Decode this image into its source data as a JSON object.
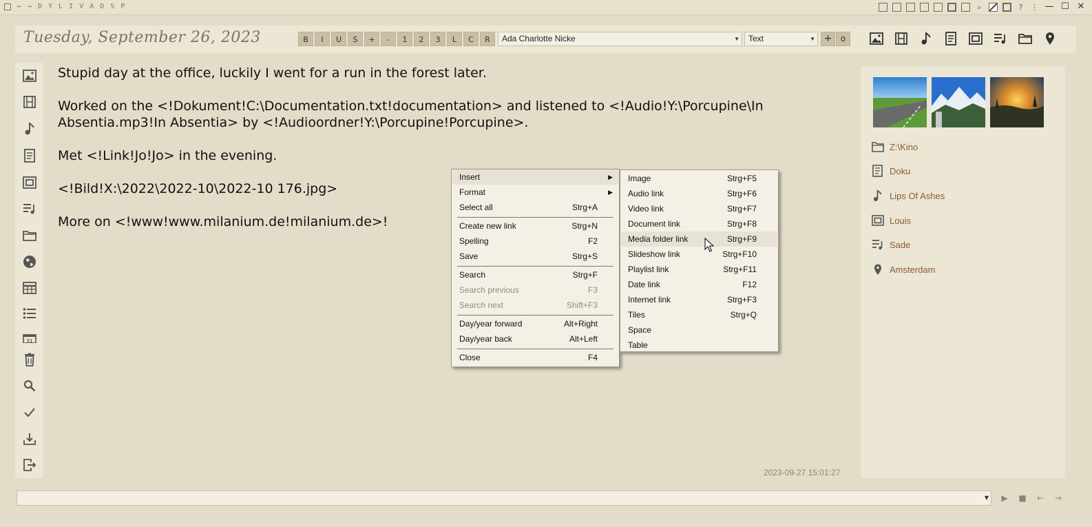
{
  "titlebar": {
    "letters": [
      "D",
      "Y",
      "L",
      "I",
      "V",
      "A",
      "D",
      "S",
      "P"
    ],
    "right_icons": [
      "window-icon",
      "list-icon",
      "lock-icon",
      "bookmark-icon",
      "grid-icon",
      "frame-icon",
      "page-icon",
      "search-icon",
      "image-edit-icon",
      "columns-icon",
      "help-icon"
    ],
    "help": "?",
    "more": "⋮"
  },
  "header": {
    "date": "Tuesday, September 26, 2023",
    "format_buttons": [
      "B",
      "I",
      "U",
      "S",
      "+",
      "-",
      "1",
      "2",
      "3",
      "L",
      "C",
      "R"
    ],
    "font_value": "Ada Charlotte Nicke",
    "style_value": "Text",
    "plus": "+",
    "o": "o",
    "media_icons": [
      "image-icon",
      "film-icon",
      "music-icon",
      "document-icon",
      "slideshow-icon",
      "playlist-icon",
      "folder-icon",
      "location-icon"
    ]
  },
  "sidebar": {
    "icons": [
      "image-icon",
      "film-icon",
      "music-icon",
      "document-icon",
      "slideshow-icon",
      "playlist-icon",
      "folder-icon",
      "globe-icon",
      "table-icon",
      "list-icon",
      "calendar-icon",
      "trash-icon",
      "search-icon",
      "check-icon",
      "download-icon",
      "exit-icon"
    ],
    "calendar_day": "31"
  },
  "editor": {
    "paragraphs": [
      "Stupid day at the office, luckily I went for a run in the forest later.",
      "Worked on the <!Dokument!C:\\Documentation.txt!documentation> and listened to <!Audio!Y:\\Porcupine\\In Absentia.mp3!In Absentia> by <!Audioordner!Y:\\Porcupine!Porcupine>.",
      "Met <!Link!Jo!Jo> in the evening.",
      "<!Bild!X:\\2022\\2022-10\\2022-10 176.jpg>",
      "More on <!www!www.milanium.de!milanium.de>!"
    ],
    "timestamp": "2023-09-27 15:01:27"
  },
  "right_panel": {
    "links": [
      {
        "icon": "folder-icon",
        "label": "Z:\\Kino"
      },
      {
        "icon": "document-icon",
        "label": "Doku"
      },
      {
        "icon": "music-icon",
        "label": "Lips Of Ashes"
      },
      {
        "icon": "slideshow-icon",
        "label": "Louis"
      },
      {
        "icon": "playlist-icon",
        "label": "Sade"
      },
      {
        "icon": "location-icon",
        "label": "Amsterdam"
      }
    ]
  },
  "context_menu": {
    "items": [
      {
        "label": "Insert",
        "shortcut": "",
        "submenu": true
      },
      {
        "label": "Format",
        "shortcut": "",
        "submenu": true
      },
      {
        "label": "Select all",
        "shortcut": "Strg+A"
      },
      {
        "label": "Create new link",
        "shortcut": "Strg+N"
      },
      {
        "label": "Spelling",
        "shortcut": "F2"
      },
      {
        "label": "Save",
        "shortcut": "Strg+S"
      },
      {
        "label": "Search",
        "shortcut": "Strg+F"
      },
      {
        "label": "Search previous",
        "shortcut": "F3",
        "disabled": true
      },
      {
        "label": "Search next",
        "shortcut": "Shift+F3",
        "disabled": true
      },
      {
        "label": "Day/year forward",
        "shortcut": "Alt+Right"
      },
      {
        "label": "Day/year back",
        "shortcut": "Alt+Left"
      },
      {
        "label": "Close",
        "shortcut": "F4"
      }
    ],
    "arrow": "▶"
  },
  "insert_submenu": {
    "items": [
      {
        "label": "Image",
        "shortcut": "Strg+F5"
      },
      {
        "label": "Audio link",
        "shortcut": "Strg+F6"
      },
      {
        "label": "Video link",
        "shortcut": "Strg+F7"
      },
      {
        "label": "Document link",
        "shortcut": "Strg+F8"
      },
      {
        "label": "Media folder link",
        "shortcut": "Strg+F9",
        "highlighted": true
      },
      {
        "label": "Slideshow link",
        "shortcut": "Strg+F10"
      },
      {
        "label": "Playlist link",
        "shortcut": "Strg+F11"
      },
      {
        "label": "Date link",
        "shortcut": "F12"
      },
      {
        "label": "Internet link",
        "shortcut": "Strg+F3"
      },
      {
        "label": "Tiles",
        "shortcut": "Strg+Q"
      },
      {
        "label": "Space",
        "shortcut": ""
      },
      {
        "label": "Table",
        "shortcut": ""
      }
    ]
  },
  "bottom_controls": [
    "dropdown-icon",
    "play-icon",
    "stop-icon",
    "back-icon",
    "forward-icon"
  ],
  "colors": {
    "background": "#e3dcc8",
    "panel": "#ece6d4",
    "link": "#8a5a35",
    "menu": "#f4f0e6"
  }
}
